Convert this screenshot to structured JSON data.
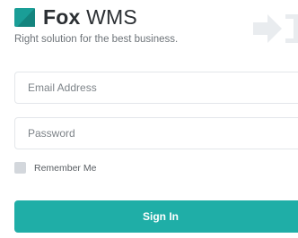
{
  "brand": {
    "name_bold": "Fox",
    "name_light": "WMS",
    "tagline": "Right solution for the best business.",
    "logo_color": "#1a9e97",
    "logo_icon": "square-logo-icon"
  },
  "login_form": {
    "email_placeholder": "Email Address",
    "email_value": "",
    "password_placeholder": "Password",
    "password_value": "",
    "remember_label": "Remember Me",
    "remember_checked": false,
    "signin_label": "Sign In"
  },
  "decoration": {
    "corner_icon": "sign-in-arrow-icon"
  },
  "colors": {
    "accent": "#1faea7",
    "text_dark": "#2b2f33",
    "text_muted": "#6d7378"
  }
}
